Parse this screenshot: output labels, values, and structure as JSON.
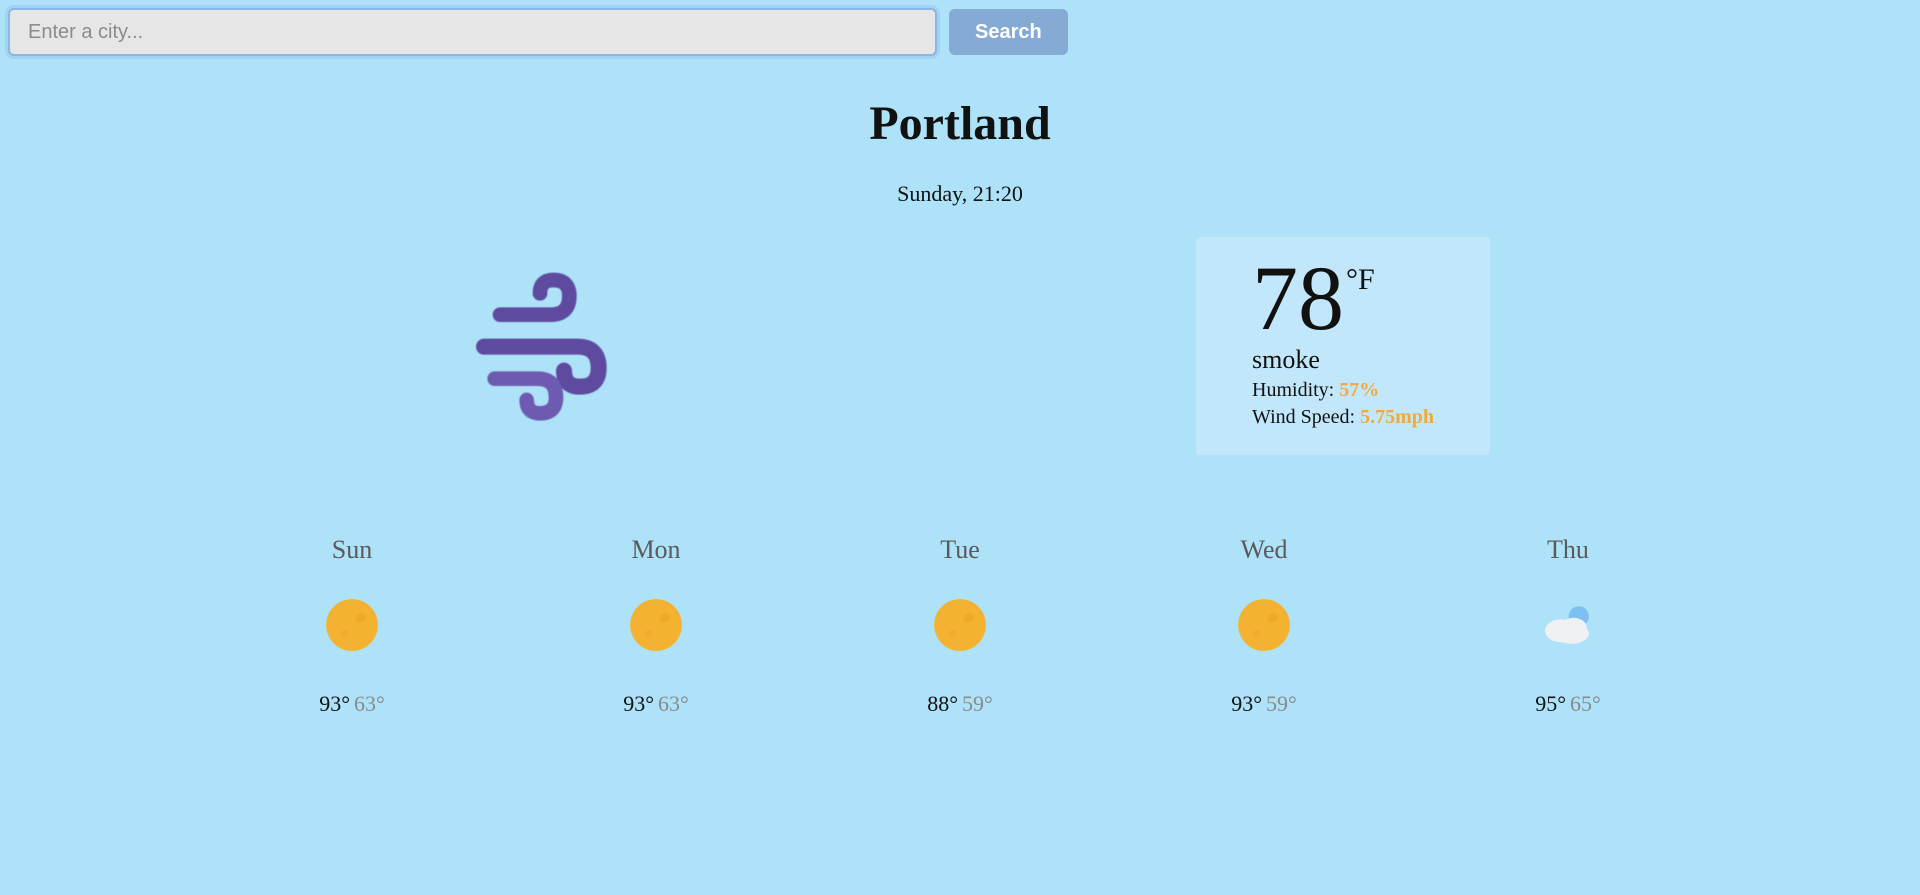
{
  "search": {
    "placeholder": "Enter a city...",
    "button_label": "Search"
  },
  "current": {
    "city": "Portland",
    "datetime": "Sunday, 21:20",
    "temp": "78",
    "unit": "°F",
    "condition": "smoke",
    "humidity_label": "Humidity: ",
    "humidity_value": "57%",
    "wind_label": "Wind Speed: ",
    "wind_value": "5.75mph",
    "icon": "wind-icon"
  },
  "forecast": [
    {
      "day": "Sun",
      "icon": "sun-icon",
      "hi": "93°",
      "lo": "63°"
    },
    {
      "day": "Mon",
      "icon": "sun-icon",
      "hi": "93°",
      "lo": "63°"
    },
    {
      "day": "Tue",
      "icon": "sun-icon",
      "hi": "88°",
      "lo": "59°"
    },
    {
      "day": "Wed",
      "icon": "sun-icon",
      "hi": "93°",
      "lo": "59°"
    },
    {
      "day": "Thu",
      "icon": "cloud-partly-icon",
      "hi": "95°",
      "lo": "65°"
    }
  ]
}
